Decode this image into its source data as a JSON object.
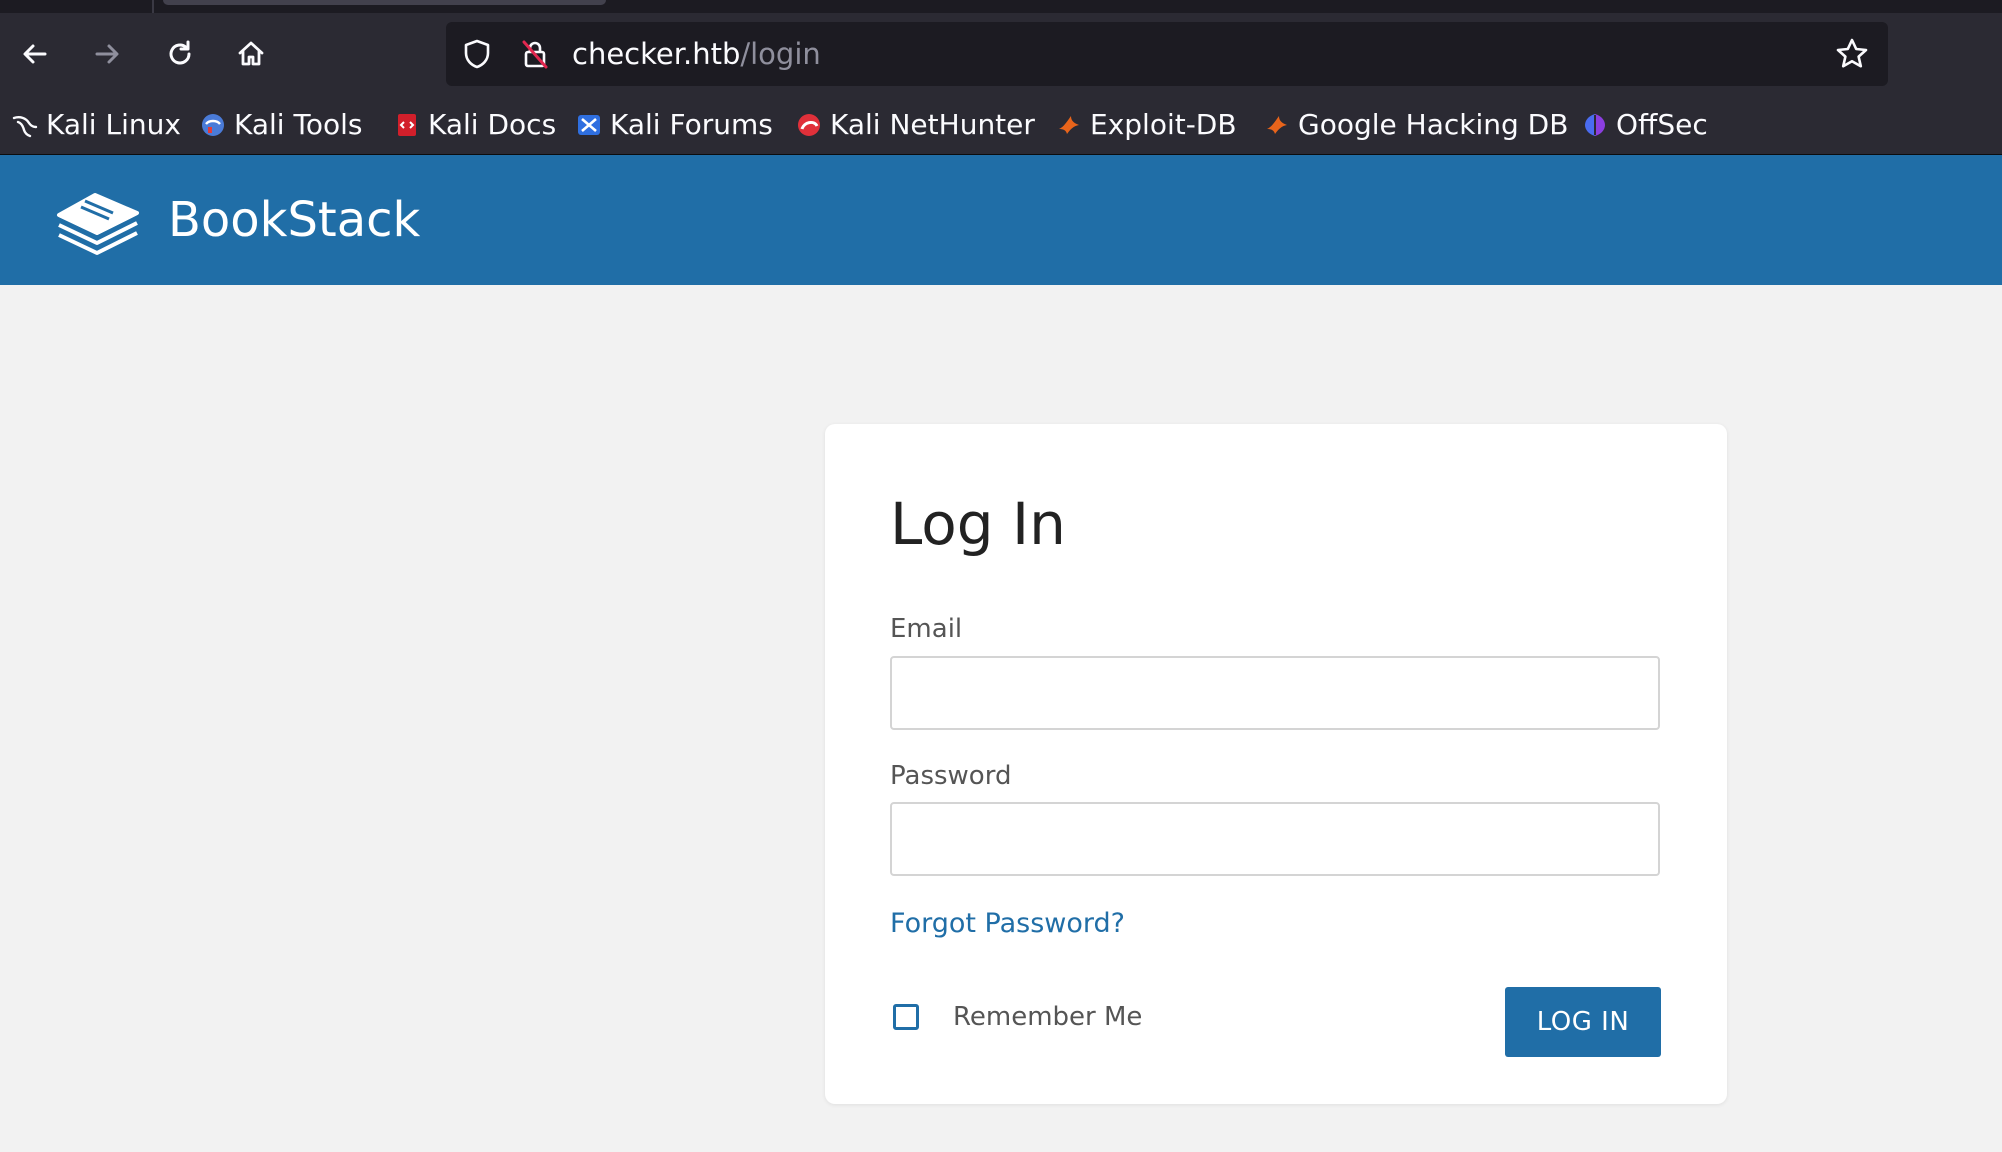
{
  "browser": {
    "url_host": "checker.htb",
    "url_path": "/login",
    "bookmarks": [
      {
        "label": "Kali Linux",
        "icon": "kali-dragon-icon"
      },
      {
        "label": "Kali Tools",
        "icon": "kali-tools-icon"
      },
      {
        "label": "Kali Docs",
        "icon": "kali-docs-icon"
      },
      {
        "label": "Kali Forums",
        "icon": "kali-forums-icon"
      },
      {
        "label": "Kali NetHunter",
        "icon": "kali-nethunter-icon"
      },
      {
        "label": "Exploit-DB",
        "icon": "exploit-db-icon"
      },
      {
        "label": "Google Hacking DB",
        "icon": "ghdb-icon"
      },
      {
        "label": "OffSec",
        "icon": "offsec-icon"
      }
    ]
  },
  "app": {
    "title": "BookStack",
    "brand_color": "#206ea7"
  },
  "login": {
    "heading": "Log In",
    "email_label": "Email",
    "email_value": "",
    "password_label": "Password",
    "password_value": "",
    "forgot_link": "Forgot Password?",
    "remember_label": "Remember Me",
    "remember_checked": false,
    "submit_label": "LOG IN"
  }
}
